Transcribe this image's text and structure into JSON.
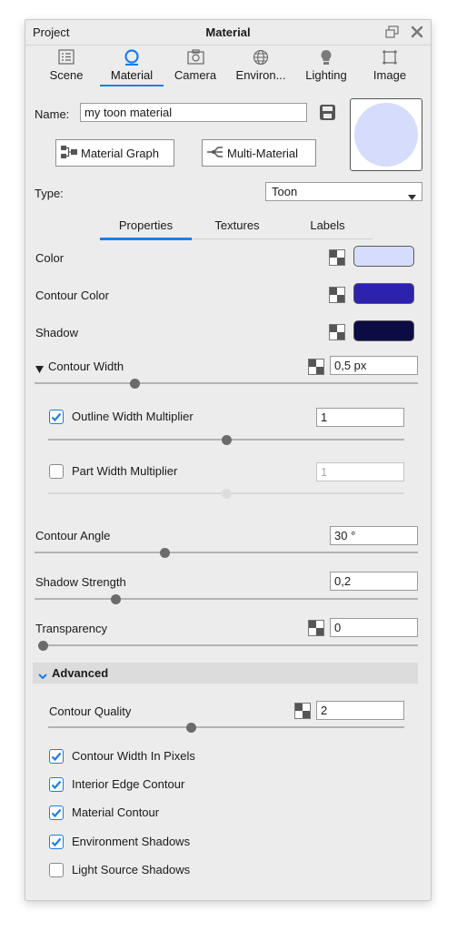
{
  "titlebar": {
    "project": "Project",
    "title": "Material"
  },
  "tabs": [
    {
      "label": "Scene",
      "icon": "list-icon"
    },
    {
      "label": "Material",
      "icon": "material-icon"
    },
    {
      "label": "Camera",
      "icon": "camera-icon"
    },
    {
      "label": "Environ...",
      "icon": "globe-icon"
    },
    {
      "label": "Lighting",
      "icon": "bulb-icon"
    },
    {
      "label": "Image",
      "icon": "frame-icon"
    }
  ],
  "name": {
    "label": "Name:",
    "value": "my toon material"
  },
  "buttons": {
    "material_graph": "Material Graph",
    "multi_material": "Multi-Material"
  },
  "type": {
    "label": "Type:",
    "value": "Toon"
  },
  "subtabs": {
    "properties": "Properties",
    "textures": "Textures",
    "labels": "Labels"
  },
  "colors": {
    "color": {
      "label": "Color",
      "value": "#d6dcfb"
    },
    "contour_color": {
      "label": "Contour Color",
      "value": "#2b22b0"
    },
    "shadow": {
      "label": "Shadow",
      "value": "#0d0b44"
    }
  },
  "contour_width": {
    "label": "Contour Width",
    "value": "0,5 px",
    "slider": 0.26
  },
  "outline_width": {
    "label": "Outline Width Multiplier",
    "value": "1",
    "checked": true,
    "slider": 0.5
  },
  "part_width": {
    "label": "Part Width Multiplier",
    "value": "1",
    "checked": false,
    "slider": 0.5
  },
  "contour_angle": {
    "label": "Contour Angle",
    "value": "30 °",
    "slider": 0.34
  },
  "shadow_strength": {
    "label": "Shadow Strength",
    "value": "0,2",
    "slider": 0.21
  },
  "transparency": {
    "label": "Transparency",
    "value": "0",
    "slider": 0.0
  },
  "advanced": {
    "header": "Advanced",
    "contour_quality": {
      "label": "Contour Quality",
      "value": "2",
      "slider": 0.4
    },
    "checks": [
      {
        "label": "Contour Width In Pixels",
        "checked": true
      },
      {
        "label": "Interior Edge Contour",
        "checked": true
      },
      {
        "label": "Material Contour",
        "checked": true
      },
      {
        "label": "Environment Shadows",
        "checked": true
      },
      {
        "label": "Light Source Shadows",
        "checked": false
      }
    ]
  },
  "accent": "#1e7ce6"
}
